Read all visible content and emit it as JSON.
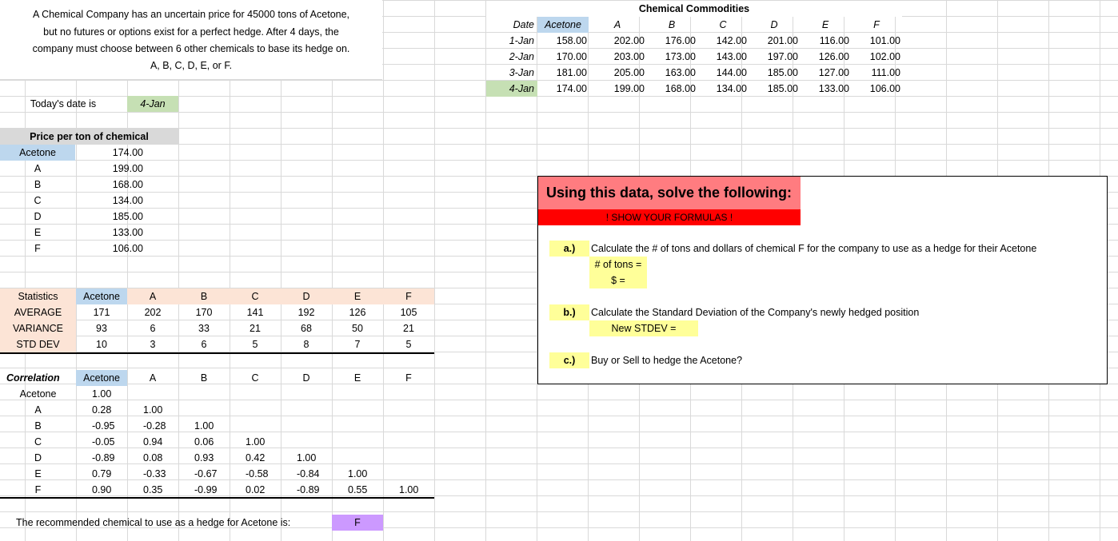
{
  "intro": {
    "line1": "A Chemical Company has an uncertain price for 45000 tons of Acetone,",
    "line2": "but no futures or options exist for a perfect hedge. After 4 days, the",
    "line3": "company must choose between 6 other chemicals to base its hedge on.",
    "line4": "A, B, C, D, E, or F."
  },
  "today": {
    "label": "Today's date is",
    "value": "4-Jan"
  },
  "price": {
    "header": "Price per ton of chemical",
    "rows": [
      {
        "label": "Acetone",
        "value": "174.00"
      },
      {
        "label": "A",
        "value": "199.00"
      },
      {
        "label": "B",
        "value": "168.00"
      },
      {
        "label": "C",
        "value": "134.00"
      },
      {
        "label": "D",
        "value": "185.00"
      },
      {
        "label": "E",
        "value": "133.00"
      },
      {
        "label": "F",
        "value": "106.00"
      }
    ]
  },
  "stats": {
    "headers": [
      "Statistics",
      "Acetone",
      "A",
      "B",
      "C",
      "D",
      "E",
      "F"
    ],
    "rows": [
      {
        "label": "AVERAGE",
        "values": [
          "171",
          "202",
          "170",
          "141",
          "192",
          "126",
          "105"
        ]
      },
      {
        "label": "VARIANCE",
        "values": [
          "93",
          "6",
          "33",
          "21",
          "68",
          "50",
          "21"
        ]
      },
      {
        "label": "STD DEV",
        "values": [
          "10",
          "3",
          "6",
          "5",
          "8",
          "7",
          "5"
        ]
      }
    ]
  },
  "corr": {
    "headers": [
      "Correlation",
      "Acetone",
      "A",
      "B",
      "C",
      "D",
      "E",
      "F"
    ],
    "rows": [
      {
        "label": "Acetone",
        "values": [
          "1.00"
        ]
      },
      {
        "label": "A",
        "values": [
          "0.28",
          "1.00"
        ]
      },
      {
        "label": "B",
        "values": [
          "-0.95",
          "-0.28",
          "1.00"
        ]
      },
      {
        "label": "C",
        "values": [
          "-0.05",
          "0.94",
          "0.06",
          "1.00"
        ]
      },
      {
        "label": "D",
        "values": [
          "-0.89",
          "0.08",
          "0.93",
          "0.42",
          "1.00"
        ]
      },
      {
        "label": "E",
        "values": [
          "0.79",
          "-0.33",
          "-0.67",
          "-0.58",
          "-0.84",
          "1.00"
        ]
      },
      {
        "label": "F",
        "values": [
          "0.90",
          "0.35",
          "-0.99",
          "0.02",
          "-0.89",
          "0.55",
          "1.00"
        ]
      }
    ]
  },
  "recommend": {
    "label": "The recommended chemical to use as a hedge for Acetone is:",
    "value": "F"
  },
  "commodities": {
    "title": "Chemical Commodities",
    "headers": [
      "Date",
      "Acetone",
      "A",
      "B",
      "C",
      "D",
      "E",
      "F"
    ],
    "rows": [
      {
        "date": "1-Jan",
        "values": [
          "158.00",
          "202.00",
          "176.00",
          "142.00",
          "201.00",
          "116.00",
          "101.00"
        ]
      },
      {
        "date": "2-Jan",
        "values": [
          "170.00",
          "203.00",
          "173.00",
          "143.00",
          "197.00",
          "126.00",
          "102.00"
        ]
      },
      {
        "date": "3-Jan",
        "values": [
          "181.00",
          "205.00",
          "163.00",
          "144.00",
          "185.00",
          "127.00",
          "111.00"
        ]
      },
      {
        "date": "4-Jan",
        "values": [
          "174.00",
          "199.00",
          "168.00",
          "134.00",
          "185.00",
          "133.00",
          "106.00"
        ]
      }
    ]
  },
  "task": {
    "title": "Using this data, solve the following:",
    "subtitle": "! SHOW YOUR FORMULAS !",
    "a_label": "a.)",
    "a_text": "Calculate the # of tons and dollars of chemical F for the company to use as a hedge for their Acetone",
    "a_tons": "# of tons =",
    "a_dollars": "$ =",
    "b_label": "b.)",
    "b_text": "Calculate the Standard Deviation of the Company's newly hedged position",
    "b_stdev": "New STDEV =",
    "c_label": "c.)",
    "c_text": "Buy or Sell to hedge the Acetone?"
  },
  "colors": {
    "acetone_header": "#bdd7ee",
    "today_value": "#c6e0b4",
    "price_header": "#d9d9d9",
    "stats_header": "#fce4d6",
    "task_title_bg": "#ff7c80",
    "task_subtitle_bg": "#ff0000",
    "answer_yellow": "#ffff99",
    "recommend_purple": "#cc99ff"
  }
}
